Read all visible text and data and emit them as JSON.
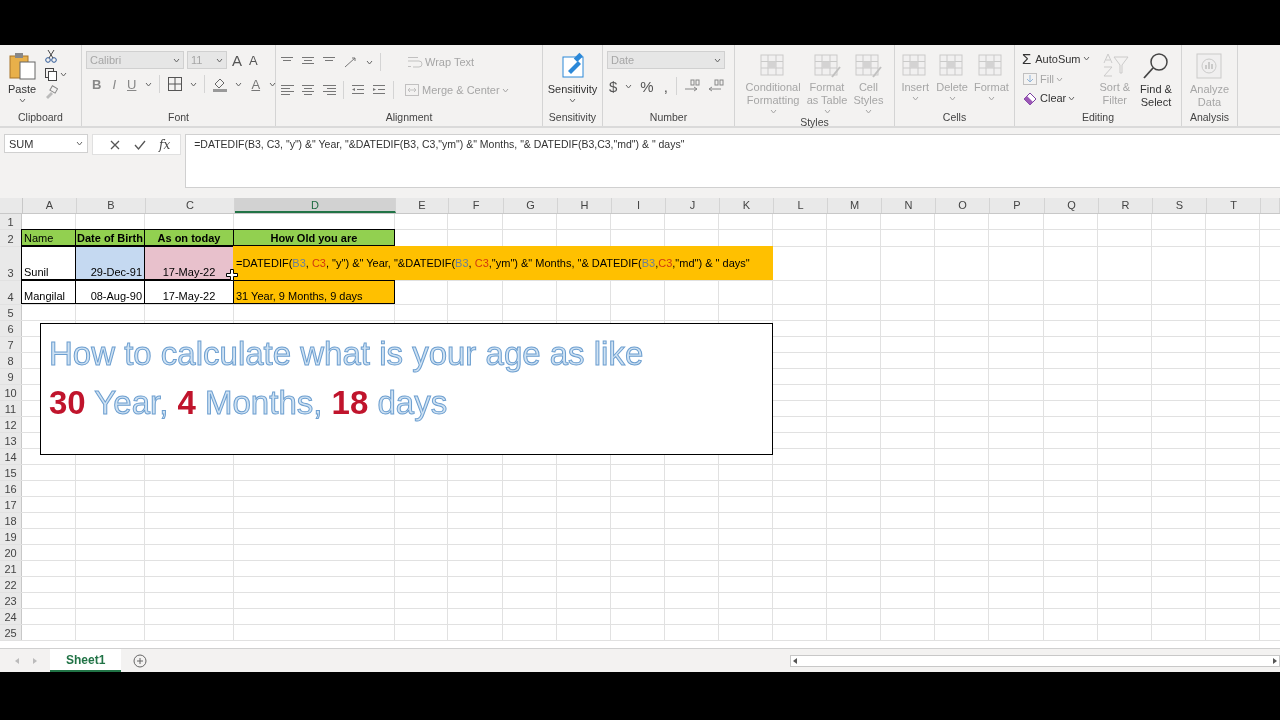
{
  "ribbon": {
    "groups": [
      {
        "kind": "clipboard",
        "label": "Clipboard",
        "commands": [
          {
            "label": "Paste",
            "disabled": false
          }
        ]
      },
      {
        "kind": "font",
        "label": "Font",
        "font_name": {
          "value": "Calibri",
          "disabled": true
        },
        "font_size": {
          "value": "11",
          "disabled": true
        },
        "size_buttons": [
          "A",
          "A"
        ],
        "format_buttons": [
          "B",
          "I",
          "U"
        ],
        "color_button": "A"
      },
      {
        "kind": "alignment",
        "label": "Alignment",
        "commands": [
          {
            "label": "Wrap Text",
            "disabled": true
          },
          {
            "label": "Merge & Center",
            "disabled": true
          }
        ]
      },
      {
        "kind": "large",
        "label": "Sensitivity",
        "commands": [
          {
            "label": "Sensitivity",
            "disabled": false
          }
        ]
      },
      {
        "kind": "number",
        "label": "Number",
        "format": {
          "value": "Date",
          "disabled": true
        },
        "symbols": [
          "$",
          "%",
          ","
        ]
      },
      {
        "kind": "large",
        "label": "Styles",
        "commands": [
          {
            "label": "Conditional Formatting",
            "disabled": true
          },
          {
            "label": "Format as Table",
            "disabled": true
          },
          {
            "label": "Cell Styles",
            "disabled": true
          }
        ]
      },
      {
        "kind": "large",
        "label": "Cells",
        "commands": [
          {
            "label": "Insert",
            "disabled": true
          },
          {
            "label": "Delete",
            "disabled": true
          },
          {
            "label": "Format",
            "disabled": true
          }
        ]
      },
      {
        "kind": "editing",
        "label": "Editing",
        "commands": [
          {
            "icon_text": "Σ",
            "label": "AutoSum",
            "disabled": false
          },
          {
            "label": "Fill",
            "disabled": true
          },
          {
            "label": "Clear",
            "disabled": false
          },
          {
            "label": "Sort & Filter",
            "disabled": true
          },
          {
            "label": "Find & Select",
            "disabled": false
          }
        ]
      },
      {
        "kind": "large",
        "label": "Analysis",
        "commands": [
          {
            "label": "Analyze Data",
            "disabled": true
          }
        ]
      }
    ]
  },
  "formula_bar": {
    "name_box": "SUM",
    "function_button": "fx",
    "formula": "=DATEDIF(B3, C3, \"y\") &\" Year, \"&DATEDIF(B3, C3,\"ym\") &\" Months, \"& DATEDIF(B3,C3,\"md\") & \" days\""
  },
  "sheet": {
    "columns": [
      {
        "label": "A",
        "selected": false
      },
      {
        "label": "B",
        "selected": false
      },
      {
        "label": "C",
        "selected": false
      },
      {
        "label": "D",
        "selected": true
      },
      {
        "label": "E",
        "selected": false
      },
      {
        "label": "F",
        "selected": false
      },
      {
        "label": "G",
        "selected": false
      },
      {
        "label": "H",
        "selected": false
      },
      {
        "label": "I",
        "selected": false
      },
      {
        "label": "J",
        "selected": false
      },
      {
        "label": "K",
        "selected": false
      },
      {
        "label": "L",
        "selected": false
      },
      {
        "label": "M",
        "selected": false
      },
      {
        "label": "N",
        "selected": false
      },
      {
        "label": "O",
        "selected": false
      },
      {
        "label": "P",
        "selected": false
      },
      {
        "label": "Q",
        "selected": false
      },
      {
        "label": "R",
        "selected": false
      },
      {
        "label": "S",
        "selected": false
      },
      {
        "label": "T",
        "selected": false
      }
    ],
    "rows": [
      {
        "number": "1"
      },
      {
        "number": "2",
        "cells": [
          {
            "kind": "text",
            "text": "Name",
            "color": "#92d050"
          },
          {
            "kind": "header",
            "text": "Date of Birth",
            "color": "#92d050"
          },
          {
            "kind": "header",
            "text": "As on today",
            "color": "#92d050"
          },
          {
            "kind": "header",
            "text": "How Old you are",
            "color": "#92d050"
          }
        ]
      },
      {
        "number": "3",
        "cells": [
          {
            "kind": "text",
            "text": "Sunil"
          },
          {
            "kind": "date",
            "text": "29-Dec-91",
            "color": "#c5d9f1"
          },
          {
            "kind": "date",
            "text": "17-May-22",
            "color": "#e8c1cc"
          },
          {
            "kind": "formula",
            "text": "=DATEDIF(*B3*, **C3**, \"y\") &\" Year, \"&DATEDIF(*B3*, **C3**,\"ym\") &\" Months, \"& DATEDIF(*B3*,**C3**,\"md\") & \" days\"",
            "color": "#ffc000"
          }
        ]
      },
      {
        "number": "4",
        "cells": [
          {
            "kind": "text",
            "text": "Mangilal"
          },
          {
            "kind": "date",
            "text": "08-Aug-90"
          },
          {
            "kind": "date",
            "text": "17-May-22"
          },
          {
            "kind": "text",
            "text": "31 Year, 9 Months, 9 days",
            "color": "#ffc000"
          }
        ]
      },
      {
        "number": "5"
      },
      {
        "number": "6"
      },
      {
        "number": "7"
      },
      {
        "number": "8"
      },
      {
        "number": "9"
      },
      {
        "number": "10"
      },
      {
        "number": "11"
      },
      {
        "number": "12"
      },
      {
        "number": "13"
      },
      {
        "number": "14"
      },
      {
        "number": "15"
      },
      {
        "number": "16"
      },
      {
        "number": "17"
      },
      {
        "number": "18"
      },
      {
        "number": "19"
      },
      {
        "number": "20"
      },
      {
        "number": "21"
      },
      {
        "number": "22"
      },
      {
        "number": "23"
      },
      {
        "number": "24"
      },
      {
        "number": "25"
      }
    ]
  },
  "text_box": {
    "lines": [
      "How to calculate what is your age as like",
      "**30** Year, **4** Months, **18** days"
    ]
  },
  "sheet_tabs": [
    {
      "label": "Sheet1",
      "selected": true
    }
  ]
}
